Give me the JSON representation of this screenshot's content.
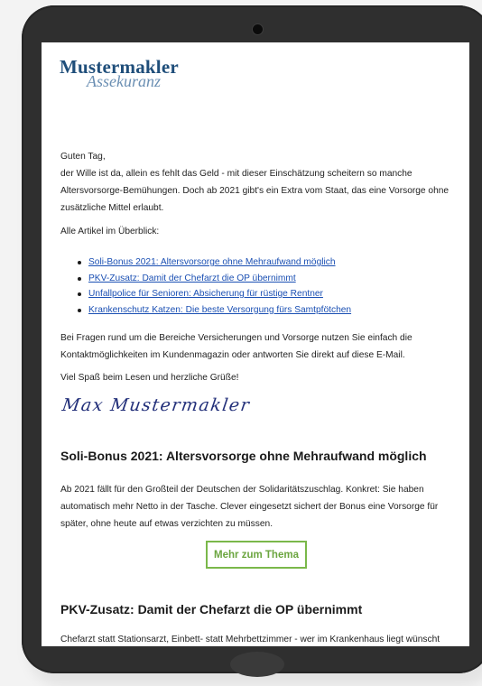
{
  "logo": {
    "line1": "Mustermakler",
    "line2": "Assekuranz"
  },
  "greeting": "Guten Tag,",
  "intro": "der Wille ist da, allein es fehlt das Geld - mit dieser Einschätzung scheitern so manche Altersvorsorge-Bemühungen. Doch ab 2021 gibt's ein Extra vom Staat, das eine Vorsorge ohne zusätzliche Mittel erlaubt.",
  "overview_label": "Alle Artikel im Überblick:",
  "articles": [
    "Soli-Bonus 2021: Altersvorsorge ohne Mehraufwand möglich",
    "PKV-Zusatz: Damit der Chefarzt die OP übernimmt",
    "Unfallpolice für Senioren: Absicherung für rüstige Rentner",
    "Krankenschutz Katzen: Die beste Versorgung fürs Samtpfötchen"
  ],
  "questions": "Bei Fragen rund um die Bereiche Versicherungen und Vorsorge nutzen Sie einfach die Kontaktmöglichkeiten im Kundenmagazin oder antworten Sie direkt auf diese E-Mail.",
  "closing": "Viel Spaß beim Lesen und herzliche Grüße!",
  "signature": "Max Mustermakler",
  "section1": {
    "title": "Soli-Bonus 2021: Altersvorsorge ohne Mehraufwand möglich",
    "text": "Ab 2021 fällt für den Großteil der Deutschen der Solidaritätszuschlag. Konkret: Sie haben automatisch mehr Netto in der Tasche. Clever eingesetzt sichert der Bonus eine Vorsorge für später, ohne heute auf etwas verzichten zu müssen.",
    "button": "Mehr zum Thema"
  },
  "section2": {
    "title": "PKV-Zusatz: Damit der Chefarzt die OP übernimmt",
    "text": "Chefarzt statt Stationsarzt, Einbett- statt Mehrbettzimmer - wer im Krankenhaus liegt wünscht"
  },
  "colors": {
    "brand": "#1f4e7a",
    "link": "#1a4fb3",
    "button": "#7ab84a"
  }
}
